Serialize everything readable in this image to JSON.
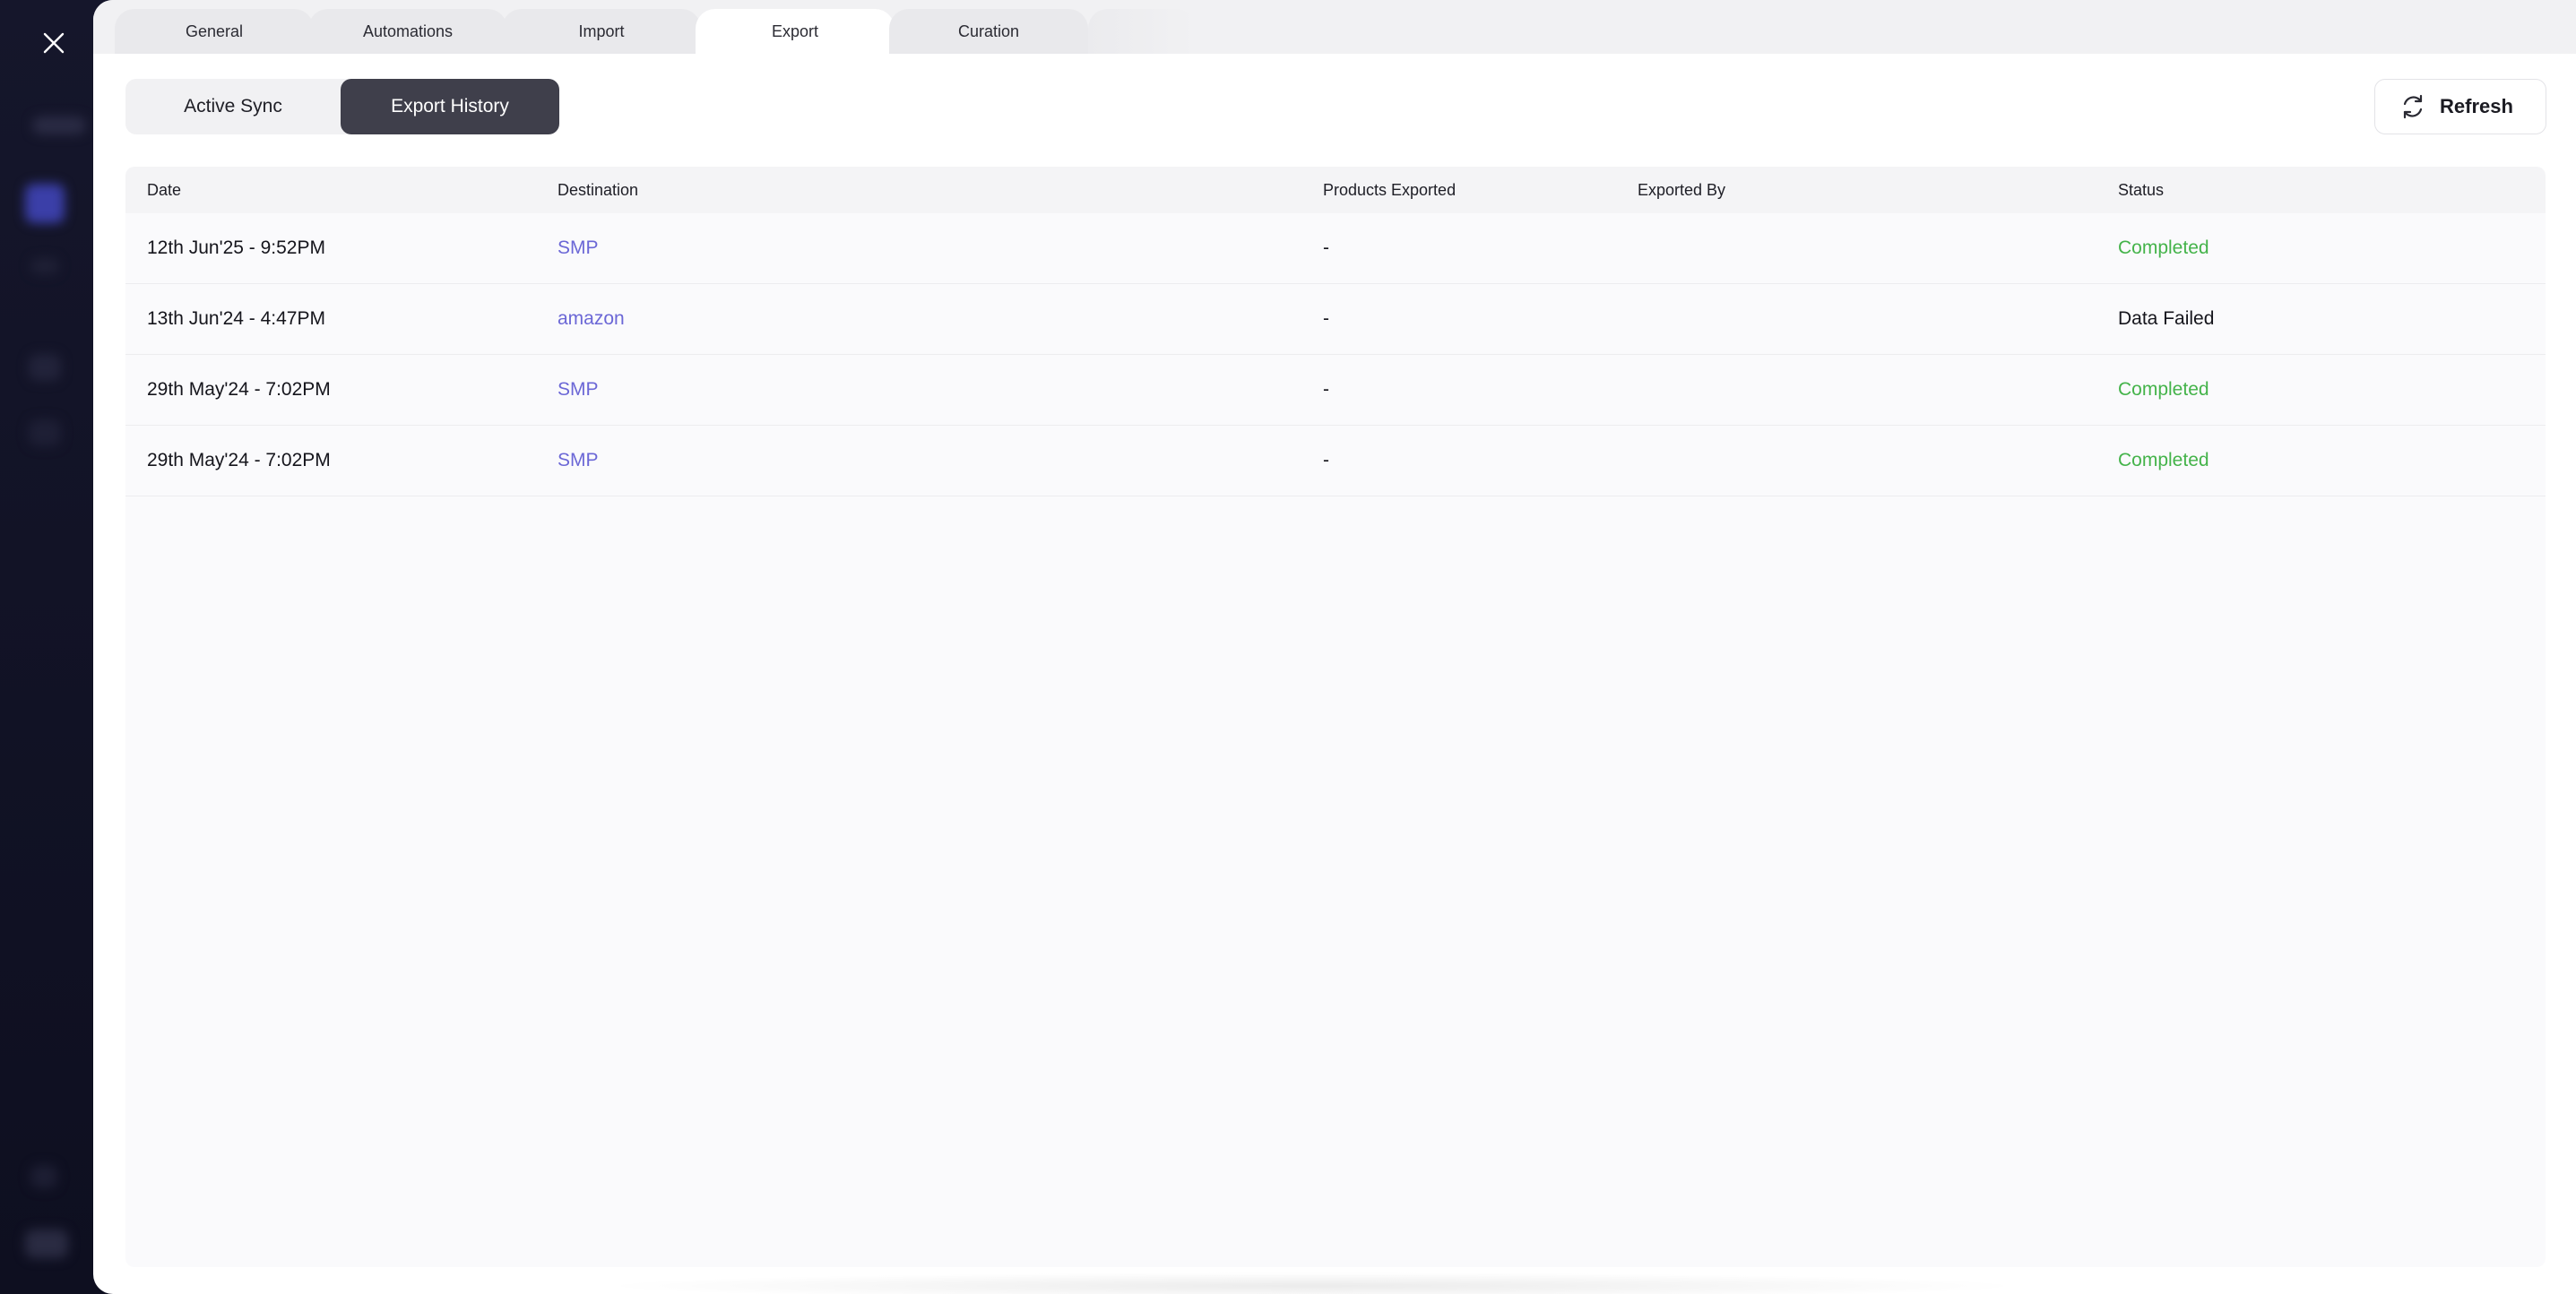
{
  "tabs": [
    "General",
    "Automations",
    "Import",
    "Export",
    "Curation"
  ],
  "active_tab": "Export",
  "segments": {
    "active_sync": "Active Sync",
    "export_history": "Export History"
  },
  "refresh_label": "Refresh",
  "table": {
    "headers": [
      "Date",
      "Destination",
      "Products Exported",
      "Exported By",
      "Status"
    ],
    "rows": [
      {
        "date": "12th Jun'25 - 9:52PM",
        "destination": "SMP",
        "products": "-",
        "exported_by": "",
        "status": "Completed"
      },
      {
        "date": "13th Jun'24 - 4:47PM",
        "destination": "amazon",
        "products": "-",
        "exported_by": "",
        "status": "Data Failed"
      },
      {
        "date": "29th May'24 - 7:02PM",
        "destination": "SMP",
        "products": "-",
        "exported_by": "",
        "status": "Completed"
      },
      {
        "date": "29th May'24 - 7:02PM",
        "destination": "SMP",
        "products": "-",
        "exported_by": "",
        "status": "Completed"
      }
    ]
  },
  "colors": {
    "accent_link": "#6b67d6",
    "status_completed": "#44b34a",
    "segment_active_bg": "#3f3f4b"
  }
}
